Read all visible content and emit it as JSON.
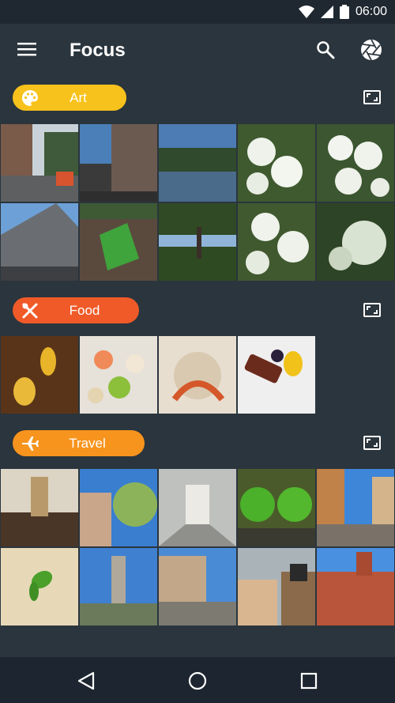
{
  "status_bar": {
    "time": "06:00",
    "icons": [
      "wifi-icon",
      "signal-icon",
      "battery-icon"
    ]
  },
  "app_bar": {
    "title": "Focus",
    "icons": [
      "menu-icon",
      "search-icon",
      "aperture-icon"
    ]
  },
  "sections": [
    {
      "label": "Art",
      "color": "#f7c21b",
      "icon": "palette-icon",
      "photo_count": 10
    },
    {
      "label": "Food",
      "color": "#f05a28",
      "icon": "cutlery-icon",
      "photo_count": 4
    },
    {
      "label": "Travel",
      "color": "#f7941d",
      "icon": "airplane-icon",
      "photo_count": 10
    }
  ],
  "nav_bar": {
    "icons": [
      "back-icon",
      "home-icon",
      "recents-icon"
    ]
  }
}
